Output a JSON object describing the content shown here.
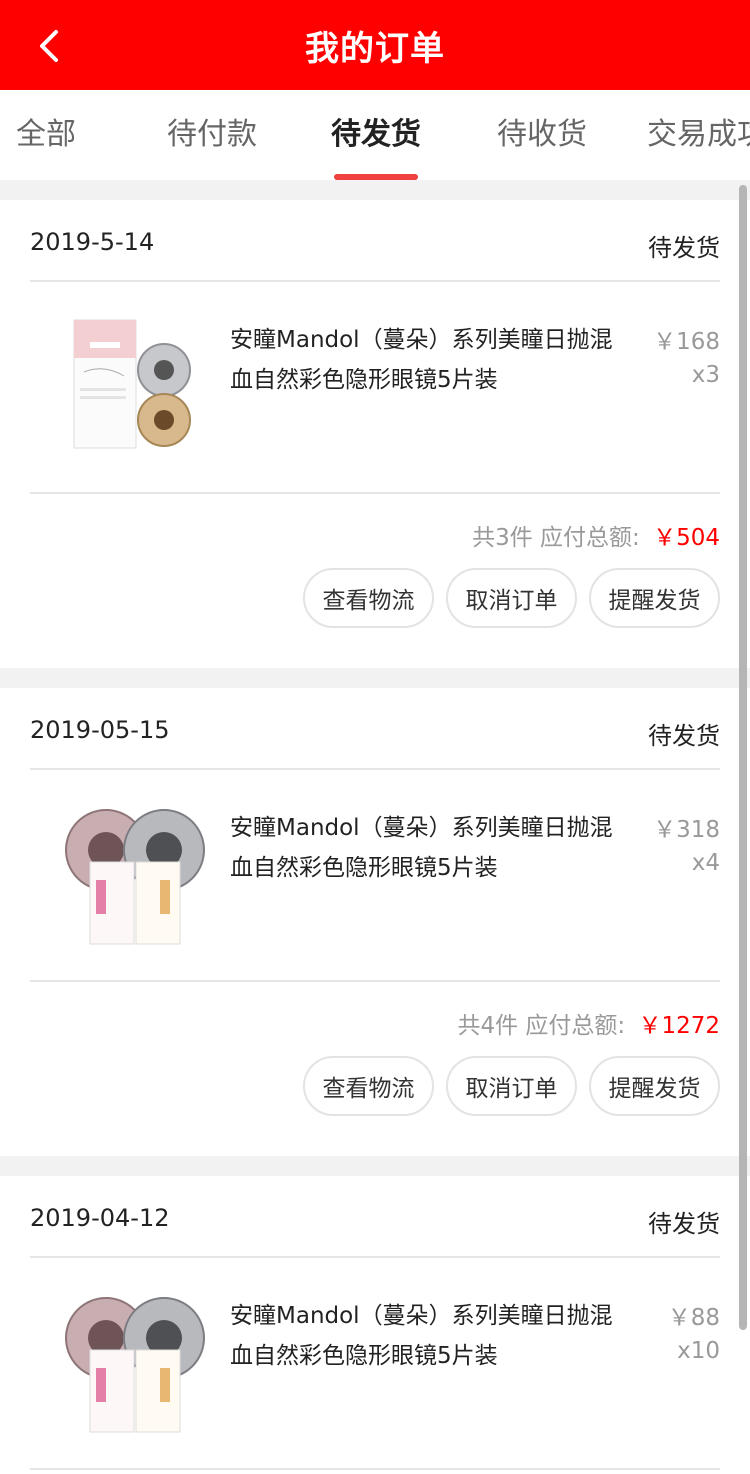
{
  "header": {
    "title": "我的订单",
    "back_icon": "chevron-left-icon"
  },
  "tabs": [
    {
      "label": "全部",
      "active": false
    },
    {
      "label": "待付款",
      "active": false
    },
    {
      "label": "待发货",
      "active": true
    },
    {
      "label": "待收货",
      "active": false
    },
    {
      "label": "交易成功",
      "active": false
    }
  ],
  "orders": [
    {
      "date": "2019-5-14",
      "status": "待发货",
      "product": {
        "name": "安瞳Mandol（蔓朵）系列美瞳日抛混血自然彩色隐形眼镜5片装",
        "price": "￥168",
        "qty": "x3",
        "image": "mandol-box-icon"
      },
      "summary": {
        "count": "共3件",
        "label": "应付总额:",
        "amount": "￥504"
      },
      "buttons": [
        "查看物流",
        "取消订单",
        "提醒发货"
      ]
    },
    {
      "date": "2019-05-15",
      "status": "待发货",
      "product": {
        "name": "安瞳Mandol（蔓朵）系列美瞳日抛混血自然彩色隐形眼镜5片装",
        "price": "￥318",
        "qty": "x4",
        "image": "lens-boxes-icon"
      },
      "summary": {
        "count": "共4件",
        "label": "应付总额:",
        "amount": "￥1272"
      },
      "buttons": [
        "查看物流",
        "取消订单",
        "提醒发货"
      ]
    },
    {
      "date": "2019-04-12",
      "status": "待发货",
      "product": {
        "name": "安瞳Mandol（蔓朵）系列美瞳日抛混血自然彩色隐形眼镜5片装",
        "price": "￥88",
        "qty": "x10",
        "image": "lens-boxes-icon"
      }
    }
  ],
  "colors": {
    "brand": "#ff0000",
    "tab_indicator": "#f04040",
    "price_highlight": "#ff0000"
  }
}
